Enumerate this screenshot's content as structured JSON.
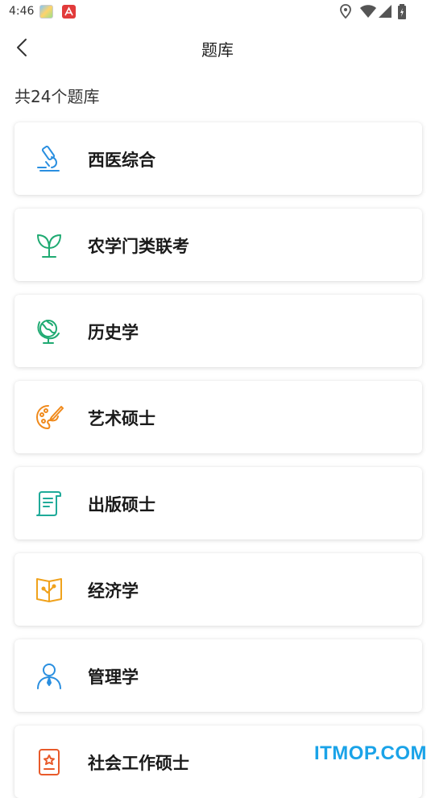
{
  "status_bar": {
    "time": "4:46"
  },
  "nav": {
    "title": "题库"
  },
  "summary": {
    "count_text": "共24个题库"
  },
  "banks": [
    {
      "label": "西医综合",
      "icon": "microscope-icon",
      "color": "#2a8fe0"
    },
    {
      "label": "农学门类联考",
      "icon": "sprout-icon",
      "color": "#1faa72"
    },
    {
      "label": "历史学",
      "icon": "globe-icon",
      "color": "#1faa72"
    },
    {
      "label": "艺术硕士",
      "icon": "palette-icon",
      "color": "#f08a1c"
    },
    {
      "label": "出版硕士",
      "icon": "scroll-icon",
      "color": "#1faa99"
    },
    {
      "label": "经济学",
      "icon": "book-icon",
      "color": "#f0a21c"
    },
    {
      "label": "管理学",
      "icon": "manager-icon",
      "color": "#2a8fe0"
    },
    {
      "label": "社会工作硕士",
      "icon": "badge-icon",
      "color": "#e85a2a"
    }
  ],
  "watermark": {
    "text": "ITMOP.COM"
  }
}
